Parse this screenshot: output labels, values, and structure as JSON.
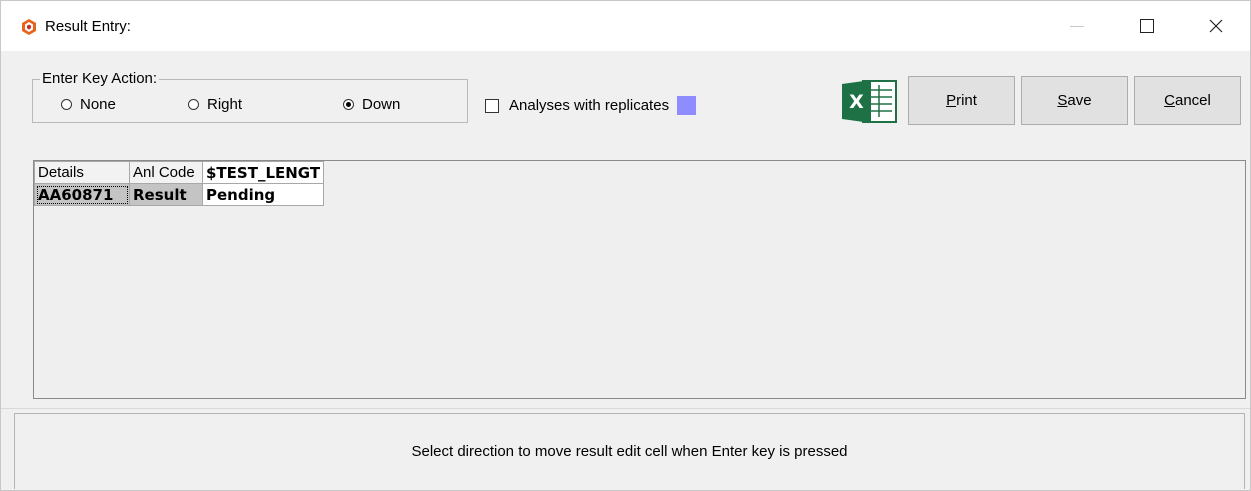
{
  "window": {
    "title": "Result Entry:"
  },
  "enter_key": {
    "legend": "Enter Key Action:",
    "options": [
      {
        "label": "None",
        "selected": false
      },
      {
        "label": "Right",
        "selected": false
      },
      {
        "label": "Down",
        "selected": true
      }
    ]
  },
  "replicates": {
    "label": "Analyses with replicates",
    "checked": false,
    "swatch_color": "#8e8cff"
  },
  "toolbar": {
    "excel_icon": "excel-icon",
    "print_label": "Print",
    "print_mnemonic": "P",
    "save_label": "Save",
    "save_mnemonic": "S",
    "cancel_label": "Cancel",
    "cancel_mnemonic": "C"
  },
  "grid": {
    "headers": [
      "Details",
      "Anl Code",
      "$TEST_LENGT"
    ],
    "rows": [
      [
        "AA60871",
        "Result",
        "Pending"
      ]
    ]
  },
  "status": {
    "message": "Select direction to move result edit cell when Enter key is pressed"
  }
}
